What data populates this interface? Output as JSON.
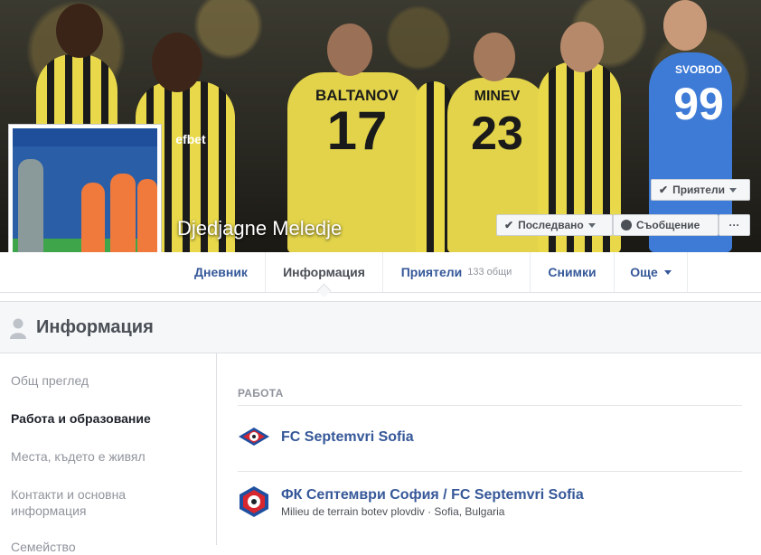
{
  "profile": {
    "name": "Djedjagne Meledje"
  },
  "cover": {
    "shirt_names": [
      "BALTANOV",
      "MINEV",
      "SVOBOD"
    ],
    "shirt_numbers": [
      "17",
      "23",
      "99"
    ],
    "sponsor": "efbet",
    "buttons": {
      "friends": "Приятели",
      "following": "Последвано",
      "message": "Съобщение",
      "more": "···"
    }
  },
  "tabs": {
    "timeline": "Дневник",
    "about": "Информация",
    "friends": "Приятели",
    "friends_count": "133 общи",
    "photos": "Снимки",
    "more": "Още"
  },
  "section": {
    "title": "Информация"
  },
  "sidebar": {
    "items": [
      {
        "label": "Общ преглед"
      },
      {
        "label": "Работа и образование"
      },
      {
        "label": "Места, където е живял"
      },
      {
        "label": "Контакти и основна информация"
      },
      {
        "label": "Семейство"
      }
    ]
  },
  "work": {
    "heading": "РАБОТА",
    "entries": [
      {
        "title": "FC Septemvri Sofia",
        "subtitle": ""
      },
      {
        "title": "ФК Септември София / FC Septemvri Sofia",
        "subtitle": "Milieu de terrain botev plovdiv · Sofia, Bulgaria"
      }
    ]
  },
  "colors": {
    "link": "#365899",
    "muted": "#90949c",
    "shirt_yellow": "#e2d34a",
    "keeper_blue": "#3e7bd6",
    "club_red": "#d8262f",
    "club_blue": "#1f4fa0"
  }
}
